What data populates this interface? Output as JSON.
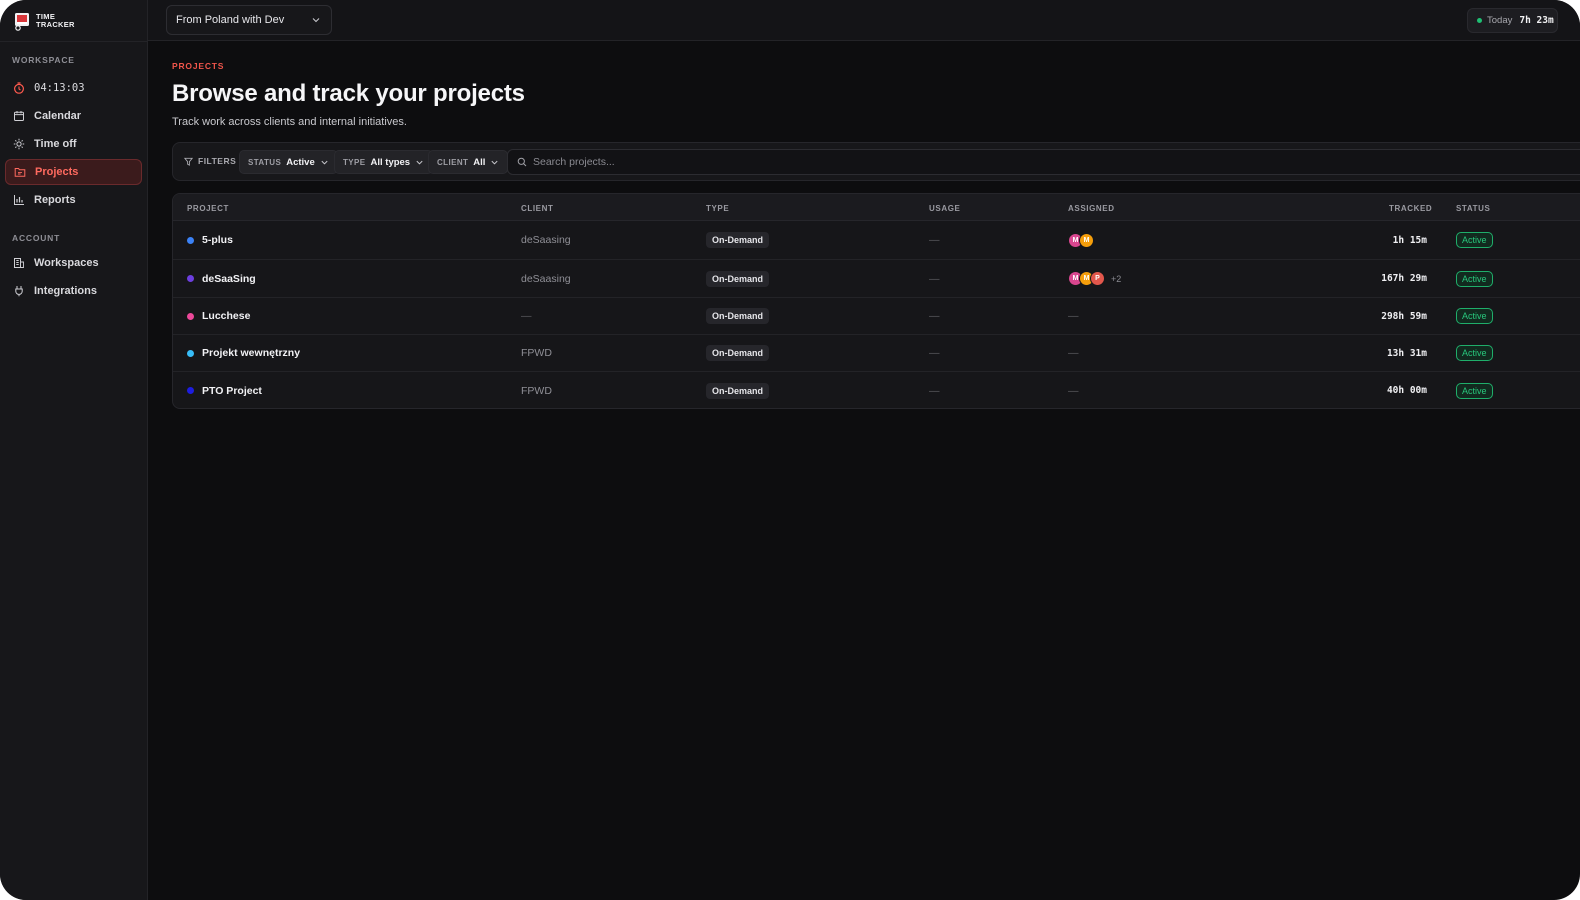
{
  "app": {
    "logo_line1": "TIME",
    "logo_line2": "TRACKER"
  },
  "sidebar": {
    "workspace_label": "WORKSPACE",
    "timer": "04:13:03",
    "items": [
      {
        "label": "Calendar",
        "icon": "calendar-icon"
      },
      {
        "label": "Time off",
        "icon": "sun-icon"
      },
      {
        "label": "Projects",
        "icon": "folder-icon"
      },
      {
        "label": "Reports",
        "icon": "bar-chart-icon"
      }
    ],
    "account_label": "ACCOUNT",
    "account_items": [
      {
        "label": "Workspaces",
        "icon": "building-icon"
      },
      {
        "label": "Integrations",
        "icon": "plug-icon"
      }
    ]
  },
  "topbar": {
    "workspace": "From Poland with Dev",
    "today_label": "Today",
    "today_value": "7h 23m"
  },
  "page": {
    "eyebrow": "PROJECTS",
    "title": "Browse and track your projects",
    "subtitle": "Track work across clients and internal initiatives."
  },
  "filters": {
    "label": "FILTERS",
    "status_key": "STATUS",
    "status_value": "Active",
    "type_key": "TYPE",
    "type_value": "All types",
    "client_key": "CLIENT",
    "client_value": "All",
    "search_placeholder": "Search projects..."
  },
  "table": {
    "headers": {
      "project": "PROJECT",
      "client": "CLIENT",
      "type": "TYPE",
      "usage": "USAGE",
      "assigned": "ASSIGNED",
      "tracked": "TRACKED",
      "status": "STATUS"
    },
    "rows": [
      {
        "name": "5-plus",
        "color": "#3b82f6",
        "client": "deSaasing",
        "type": "On-Demand",
        "usage": "—",
        "assigned": [
          {
            "i": "M",
            "c": "#d9468f"
          },
          {
            "i": "M",
            "c": "#f59e0b"
          }
        ],
        "more": "",
        "tracked": "1h 15m",
        "status": "Active"
      },
      {
        "name": "deSaaSing",
        "color": "#6d3fe0",
        "client": "deSaasing",
        "type": "On-Demand",
        "usage": "—",
        "assigned": [
          {
            "i": "M",
            "c": "#d9468f"
          },
          {
            "i": "M",
            "c": "#f59e0b"
          },
          {
            "i": "P",
            "c": "#e2574c"
          }
        ],
        "more": "+2",
        "tracked": "167h 29m",
        "status": "Active"
      },
      {
        "name": "Lucchese",
        "color": "#ec4899",
        "client": "—",
        "type": "On-Demand",
        "usage": "—",
        "assigned": [],
        "assigned_text": "—",
        "more": "",
        "tracked": "298h 59m",
        "status": "Active"
      },
      {
        "name": "Projekt wewnętrzny",
        "color": "#38bdf8",
        "client": "FPWD",
        "type": "On-Demand",
        "usage": "—",
        "assigned": [],
        "assigned_text": "—",
        "more": "",
        "tracked": "13h 31m",
        "status": "Active"
      },
      {
        "name": "PTO Project",
        "color": "#1d1de0",
        "client": "FPWD",
        "type": "On-Demand",
        "usage": "—",
        "assigned": [],
        "assigned_text": "—",
        "more": "",
        "tracked": "40h 00m",
        "status": "Active"
      }
    ]
  }
}
